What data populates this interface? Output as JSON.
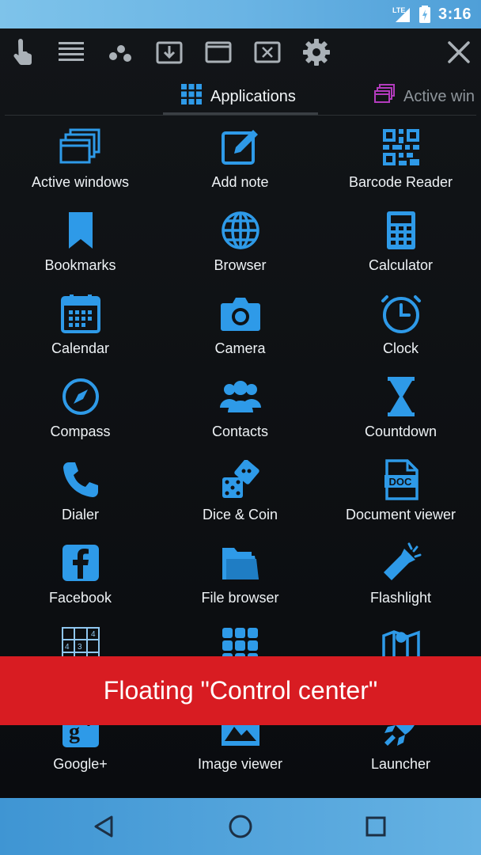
{
  "status_bar": {
    "network": "LTE",
    "time": "3:16"
  },
  "toolbar": {
    "buttons": [
      {
        "name": "touch-icon"
      },
      {
        "name": "list-icon"
      },
      {
        "name": "dots-icon"
      },
      {
        "name": "download-window-icon"
      },
      {
        "name": "maximize-icon"
      },
      {
        "name": "close-window-icon"
      },
      {
        "name": "gear-icon"
      },
      {
        "name": "close-icon"
      }
    ]
  },
  "tabs": [
    {
      "label": "Applications",
      "icon": "grid-icon",
      "selected": true
    },
    {
      "label": "Active win",
      "icon": "windows-icon",
      "selected": false
    }
  ],
  "apps": [
    {
      "label": "Active windows",
      "icon": "windows-icon"
    },
    {
      "label": "Add note",
      "icon": "note-icon"
    },
    {
      "label": "Barcode Reader",
      "icon": "qr-code-icon"
    },
    {
      "label": "Bookmarks",
      "icon": "bookmark-icon"
    },
    {
      "label": "Browser",
      "icon": "globe-icon"
    },
    {
      "label": "Calculator",
      "icon": "calculator-icon"
    },
    {
      "label": "Calendar",
      "icon": "calendar-icon"
    },
    {
      "label": "Camera",
      "icon": "camera-icon"
    },
    {
      "label": "Clock",
      "icon": "clock-icon"
    },
    {
      "label": "Compass",
      "icon": "compass-icon"
    },
    {
      "label": "Contacts",
      "icon": "contacts-icon"
    },
    {
      "label": "Countdown",
      "icon": "hourglass-icon"
    },
    {
      "label": "Dialer",
      "icon": "phone-icon"
    },
    {
      "label": "Dice & Coin",
      "icon": "dice-icon"
    },
    {
      "label": "Document viewer",
      "icon": "doc-icon"
    },
    {
      "label": "Facebook",
      "icon": "facebook-icon"
    },
    {
      "label": "File browser",
      "icon": "folder-icon"
    },
    {
      "label": "Flashlight",
      "icon": "flashlight-icon"
    },
    {
      "label": "",
      "icon": "sudoku-icon"
    },
    {
      "label": "",
      "icon": "apps-grid-icon"
    },
    {
      "label": "",
      "icon": "map-icon"
    },
    {
      "label": "Google+",
      "icon": "google-plus-icon"
    },
    {
      "label": "Image viewer",
      "icon": "image-icon"
    },
    {
      "label": "Launcher",
      "icon": "rocket-icon"
    }
  ],
  "banner": {
    "text": "Floating \"Control center\""
  },
  "nav_bar": {
    "buttons": [
      {
        "name": "back-icon"
      },
      {
        "name": "home-icon"
      },
      {
        "name": "recents-icon"
      }
    ]
  },
  "colors": {
    "accent": "#2e9ae8",
    "banner": "#d81c22",
    "status_bar": "#6ab4e4",
    "tab_accent_secondary": "#b33bbd"
  }
}
